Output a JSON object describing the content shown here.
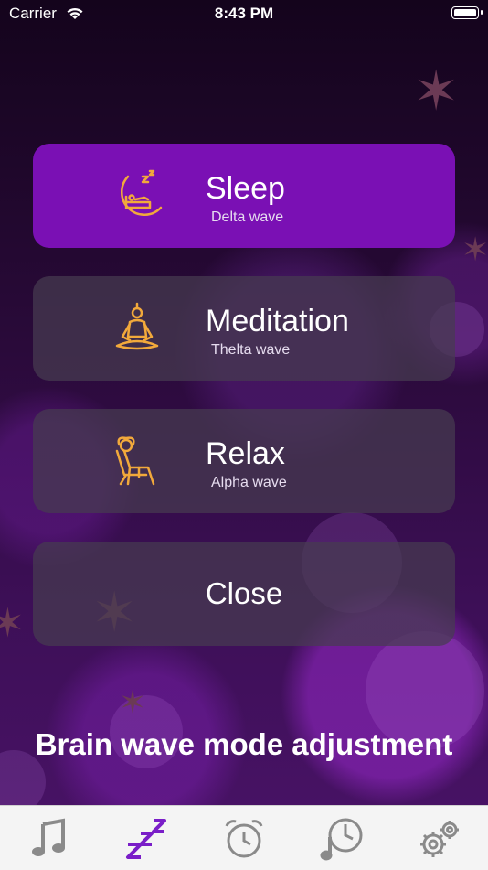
{
  "status_bar": {
    "carrier": "Carrier",
    "time": "8:43 PM"
  },
  "modes": [
    {
      "title": "Sleep",
      "subtitle": "Delta wave",
      "icon": "sleep-moon-icon",
      "active": true
    },
    {
      "title": "Meditation",
      "subtitle": "Thelta wave",
      "icon": "meditation-icon",
      "active": false
    },
    {
      "title": "Relax",
      "subtitle": "Alpha wave",
      "icon": "relax-chair-icon",
      "active": false
    }
  ],
  "close_label": "Close",
  "footer_text": "Brain wave mode adjustment",
  "tabbar": {
    "tabs": [
      {
        "icon": "music-note-icon",
        "active": false
      },
      {
        "icon": "zzz-icon",
        "active": true
      },
      {
        "icon": "alarm-clock-icon",
        "active": false
      },
      {
        "icon": "clock-music-icon",
        "active": false
      },
      {
        "icon": "gears-icon",
        "active": false
      }
    ]
  },
  "colors": {
    "accent": "#7a10b4",
    "icon_gold": "#f2a93b",
    "tab_active": "#7a1ec8",
    "tab_inactive": "#8a8a8a"
  }
}
